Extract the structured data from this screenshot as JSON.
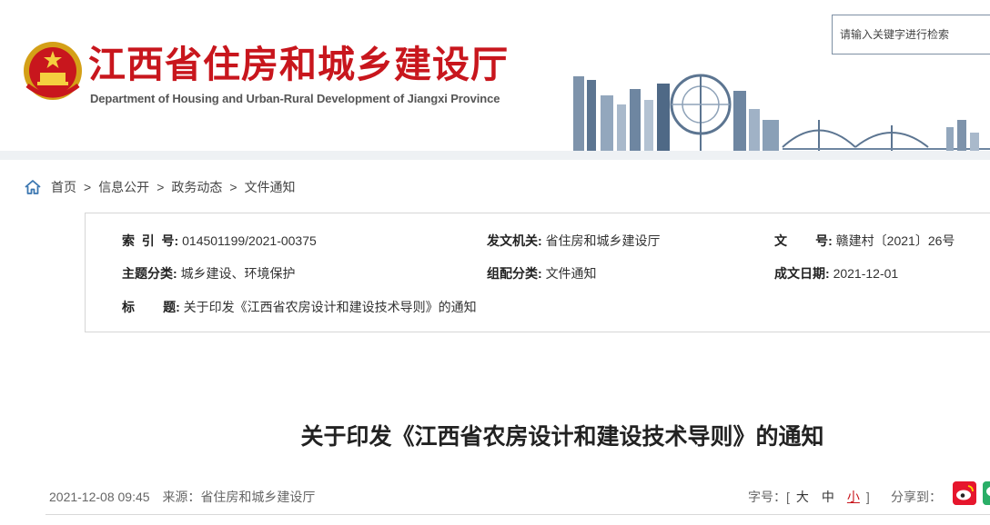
{
  "header": {
    "title": "江西省住房和城乡建设厅",
    "subtitle": "Department of Housing and Urban-Rural Development of Jiangxi Province",
    "search": {
      "placeholder": "请输入关键字进行检索"
    }
  },
  "breadcrumb": {
    "items": [
      "首页",
      "信息公开",
      "政务动态",
      "文件通知"
    ],
    "separator": ">"
  },
  "info": {
    "index_label": "索  引  号:",
    "index_value": "014501199/2021-00375",
    "issuer_label": "发文机关:",
    "issuer_value": "省住房和城乡建设厅",
    "docno_label": "文        号:",
    "docno_value": "赣建村〔2021〕26号",
    "topic_label": "主题分类:",
    "topic_value": "城乡建设、环境保护",
    "category_label": "组配分类:",
    "category_value": "文件通知",
    "date_label": "成文日期:",
    "date_value": "2021-12-01",
    "title_label": "标        题:",
    "title_value": "关于印发《江西省农房设计和建设技术导则》的通知"
  },
  "article": {
    "title": "关于印发《江西省农房设计和建设技术导则》的通知",
    "datetime": "2021-12-08 09:45",
    "source_label": "来源：",
    "source_value": "省住房和城乡建设厅",
    "font_size_label": "字号：[",
    "font_size_close": "]",
    "font_sizes": [
      "大",
      "中",
      "小"
    ],
    "share_label": "分享到："
  },
  "colors": {
    "brand_red": "#c8161d",
    "link_red": "#c8161d",
    "border": "#d6d6d6",
    "search_border": "#7d8fa3"
  },
  "icons": [
    "national-emblem-icon",
    "skyline-illustration",
    "home-icon",
    "weibo-icon",
    "wechat-icon"
  ]
}
